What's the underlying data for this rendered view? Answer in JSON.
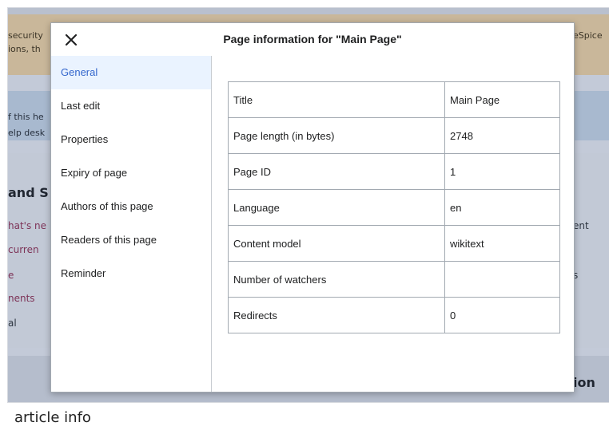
{
  "background": {
    "notice_line1": "security",
    "notice_line2": "ions, th",
    "notice_right": "eSpice",
    "band_line1": "f this he",
    "band_line2": "elp desk",
    "heading_left": "and S",
    "links_left": [
      "hat's ne",
      "curren",
      "e",
      "nents",
      "al"
    ],
    "text_right1": "ent",
    "text_right2": "s",
    "heading_right": "ion"
  },
  "dialog": {
    "title": "Page information for \"Main Page\"",
    "close_icon": "close-icon",
    "menu": [
      {
        "label": "General",
        "active": true
      },
      {
        "label": "Last edit"
      },
      {
        "label": "Properties"
      },
      {
        "label": "Expiry of page"
      },
      {
        "label": "Authors of this page"
      },
      {
        "label": "Readers of this page"
      },
      {
        "label": "Reminder"
      }
    ],
    "table": [
      {
        "key": "Title",
        "value": "Main Page"
      },
      {
        "key": "Page length (in bytes)",
        "value": "2748"
      },
      {
        "key": "Page ID",
        "value": "1"
      },
      {
        "key": "Language",
        "value": "en"
      },
      {
        "key": "Content model",
        "value": "wikitext"
      },
      {
        "key": "Number of watchers",
        "value": ""
      },
      {
        "key": "Redirects",
        "value": "0"
      }
    ]
  },
  "caption": "article info",
  "colors": {
    "active_menu_bg": "#eaf3ff",
    "active_menu_text": "#3366cc",
    "border": "#a2a9b1",
    "notice_bg": "#c9b79a",
    "overlay_bg": "#c3cad8"
  }
}
